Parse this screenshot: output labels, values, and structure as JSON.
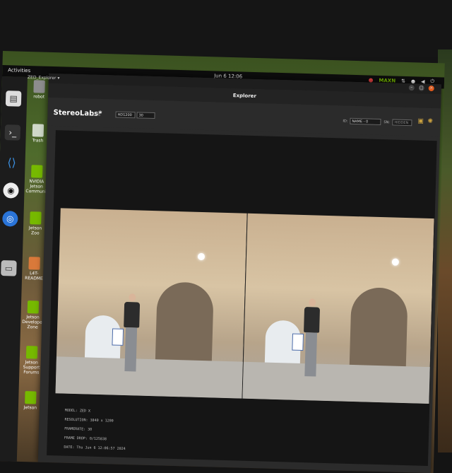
{
  "topbar": {
    "activities": "Activities",
    "app_menu": "ZED_Explorer ▾",
    "clock": "Jun 6 12:06",
    "tray_nvidia": "MAXN"
  },
  "window": {
    "title": "Explorer",
    "brand": "StereoLabs*",
    "live_label": "LIVE",
    "resolution": "HD1200",
    "fps": "30",
    "id_label": "ID:",
    "id_value": "NAME - 0",
    "sn_label": "SN:",
    "sn_value": "HIDDEN"
  },
  "desktop_icons": [
    "robot",
    "Trash",
    "NVIDIA Jetson Community",
    "Jetson Zoo",
    "L4T-README",
    "Jetson Developer Zone",
    "Jetson Support Forums",
    "Jetson"
  ],
  "camera_info": {
    "model": "MODEL: ZED X",
    "resolution": "RESOLUTION: 3840 x 1200",
    "framerate": "FRAMERATE: 30",
    "frame_drop": "FRAME DROP: 0/125838",
    "date": "DATE: Thu Jun 6 12:06:57 2024"
  }
}
